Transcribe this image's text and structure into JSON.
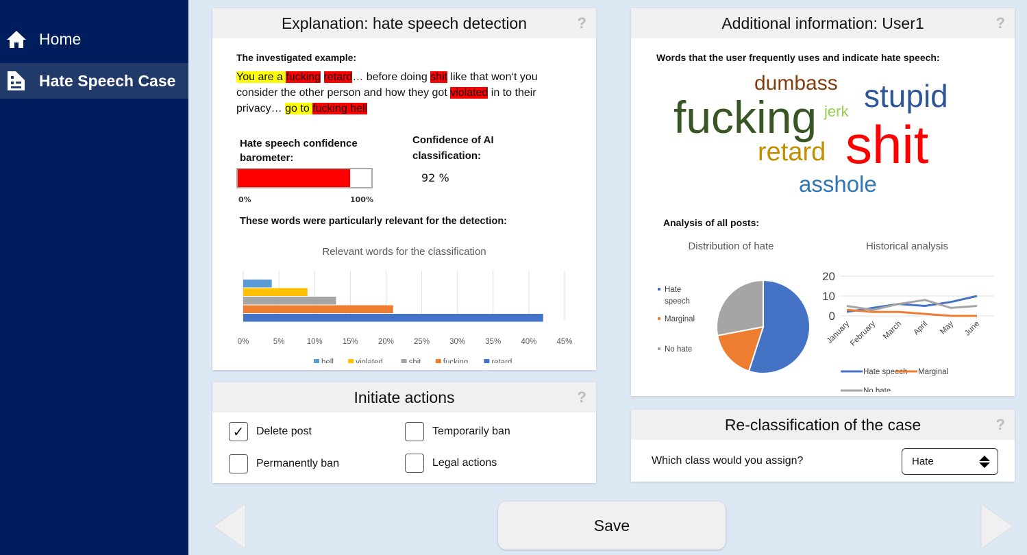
{
  "sidebar": {
    "items": [
      {
        "label": "Home",
        "icon": "home-icon"
      },
      {
        "label": "Hate Speech Case",
        "icon": "case-document-icon",
        "active": true
      }
    ]
  },
  "explanation": {
    "title": "Explanation: hate speech detection",
    "help": "?",
    "example_label": "The investigated example:",
    "example": [
      {
        "t": "You are a ",
        "h": "y"
      },
      {
        "t": "fucking",
        "h": "r"
      },
      {
        "t": " ",
        "h": ""
      },
      {
        "t": "retard",
        "h": "r"
      },
      {
        "t": "… before doing ",
        "h": ""
      },
      {
        "t": "shit",
        "h": "r"
      },
      {
        "t": " like that won‘t you consider the other person and how they got ",
        "h": ""
      },
      {
        "t": "violated",
        "h": "r"
      },
      {
        "t": " in to their privacy… ",
        "h": ""
      },
      {
        "t": "go to ",
        "h": "y"
      },
      {
        "t": "fucking hell",
        "h": "r"
      }
    ],
    "barometer_label": "Hate speech confidence barometer:",
    "barometer_value": 84,
    "barometer_min": "0%",
    "barometer_max": "100%",
    "confidence_label": "Confidence of AI classification:",
    "confidence_value": "92 %",
    "relevant_label": "These words were particularly relevant for the detection:"
  },
  "actions": {
    "title": "Initiate actions",
    "help": "?",
    "items": [
      {
        "label": "Delete post",
        "checked": true,
        "check": "✓"
      },
      {
        "label": "Temporarily ban",
        "checked": false
      },
      {
        "label": "Permanently ban",
        "checked": false
      },
      {
        "label": "Legal actions",
        "checked": false
      }
    ]
  },
  "additional": {
    "title": "Additional information: User1",
    "help": "?",
    "words_label": "Words that the user frequently uses and indicate hate speech:",
    "words": [
      {
        "w": "dumbass",
        "c": "#843c0c"
      },
      {
        "w": "stupid",
        "c": "#2f5597"
      },
      {
        "w": "fucking",
        "c": "#375623"
      },
      {
        "w": "jerk",
        "c": "#92d050"
      },
      {
        "w": "shit",
        "c": "#ff0000"
      },
      {
        "w": "retard",
        "c": "#bf9000"
      },
      {
        "w": "asshole",
        "c": "#2e75b6"
      }
    ],
    "analysis_label": "Analysis of all posts:"
  },
  "reclass": {
    "title": "Re-classification of the case",
    "help": "?",
    "question": "Which class would you assign?",
    "selected": "Hate"
  },
  "footer": {
    "save": "Save"
  },
  "chart_data": [
    {
      "type": "bar",
      "orientation": "horizontal",
      "title": "Relevant words for the classification",
      "categories": [
        "hell",
        "violated",
        "shit",
        "fucking",
        "retard"
      ],
      "values": [
        4,
        9,
        13,
        21,
        42
      ],
      "colors": [
        "#5b9bd5",
        "#ffc000",
        "#a5a5a5",
        "#ed7d31",
        "#4472c4"
      ],
      "xlim": [
        0,
        45
      ],
      "ticks": [
        "0%",
        "5%",
        "10%",
        "15%",
        "20%",
        "25%",
        "30%",
        "35%",
        "40%",
        "45%"
      ],
      "legend": "bottom"
    },
    {
      "type": "pie",
      "title": "Distribution of hate",
      "categories": [
        "Hate speech",
        "Marginal",
        "No hate"
      ],
      "values": [
        55,
        17,
        28
      ],
      "colors": [
        "#4472c4",
        "#ed7d31",
        "#a5a5a5"
      ],
      "legend": "left"
    },
    {
      "type": "line",
      "title": "Historical analysis",
      "x": [
        "January",
        "February",
        "March",
        "April",
        "May",
        "June"
      ],
      "ylim": [
        0,
        20
      ],
      "yticks": [
        "0",
        "10",
        "20"
      ],
      "series": [
        {
          "name": "Hate speech",
          "values": [
            2,
            4,
            6,
            5,
            7,
            10
          ],
          "color": "#4472c4"
        },
        {
          "name": "Marginal",
          "values": [
            3,
            2,
            2,
            1,
            0,
            0
          ],
          "color": "#ed7d31"
        },
        {
          "name": "No hate",
          "values": [
            5,
            3,
            6,
            8,
            4,
            5
          ],
          "color": "#a5a5a5"
        }
      ],
      "legend": "bottom"
    }
  ]
}
